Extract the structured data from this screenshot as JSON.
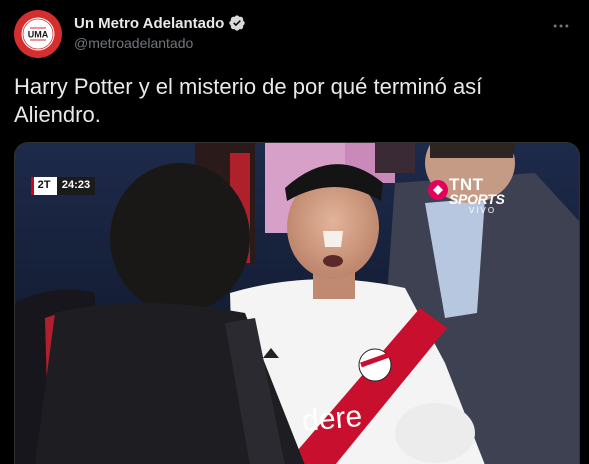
{
  "tweet": {
    "author": {
      "display_name": "Un Metro Adelantado",
      "handle": "@metroadelantado",
      "avatar_text": "UMA",
      "avatar_ring_text": "UN METRO ADELANTADO",
      "verified": true
    },
    "more_icon": "more-horizontal-icon",
    "text_line1": "Harry Potter y el misterio de por qué terminó así",
    "text_line2": "Aliendro."
  },
  "media": {
    "broadcast": {
      "period": "2T",
      "clock": "24:23",
      "network_line1": "TNT",
      "network_line2": "SPORTS",
      "network_line3": "VIVO"
    },
    "jersey_sponsor": "adidas",
    "shirt_text": "dere"
  },
  "colors": {
    "background": "#000000",
    "text_primary": "#e7e9ea",
    "text_secondary": "#71767b",
    "verified_badge": "#d9d9d9",
    "avatar_red": "#d42e2e",
    "sash_red": "#c8102e",
    "network_pink": "#e4005b"
  }
}
